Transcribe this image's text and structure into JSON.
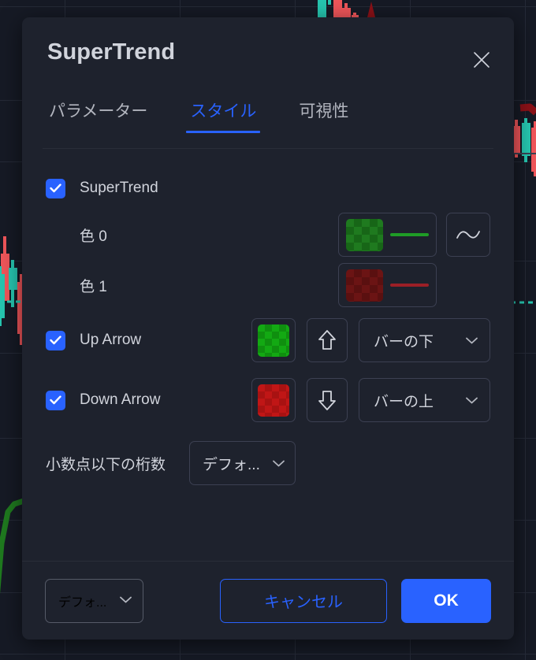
{
  "dialog": {
    "title": "SuperTrend",
    "close_icon": "close-icon"
  },
  "tabs": [
    {
      "label": "パラメーター",
      "active": false
    },
    {
      "label": "スタイル",
      "active": true
    },
    {
      "label": "可視性",
      "active": false
    }
  ],
  "body": {
    "supertrend": {
      "label": "SuperTrend",
      "checked": true
    },
    "color0": {
      "label": "色 0",
      "swatch_color": "#1f7a1f",
      "swatch_alt": "#176617",
      "line_color": "#1f9c26",
      "style_icon": "wave-line-icon"
    },
    "color1": {
      "label": "色 1",
      "swatch_color": "#6b1414",
      "swatch_alt": "#5a1010",
      "line_color": "#9c1f26"
    },
    "up_arrow": {
      "label": "Up Arrow",
      "checked": true,
      "swatch_color": "#13a913",
      "swatch_alt": "#0f8f0f",
      "arrow_icon": "arrow-up-outline-icon",
      "position": "バーの下"
    },
    "down_arrow": {
      "label": "Down Arrow",
      "checked": true,
      "swatch_color": "#c01616",
      "swatch_alt": "#a81212",
      "arrow_icon": "arrow-down-outline-icon",
      "position": "バーの上"
    },
    "precision": {
      "label": "小数点以下の桁数",
      "value": "デフォ..."
    }
  },
  "footer": {
    "template_select": "デフォ...",
    "cancel_label": "キャンセル",
    "ok_label": "OK"
  },
  "colors": {
    "accent": "#2962ff",
    "dialog_bg": "#1e222d",
    "chart_bg": "#161a25",
    "text": "#d1d4dc",
    "border": "#3c4052"
  }
}
